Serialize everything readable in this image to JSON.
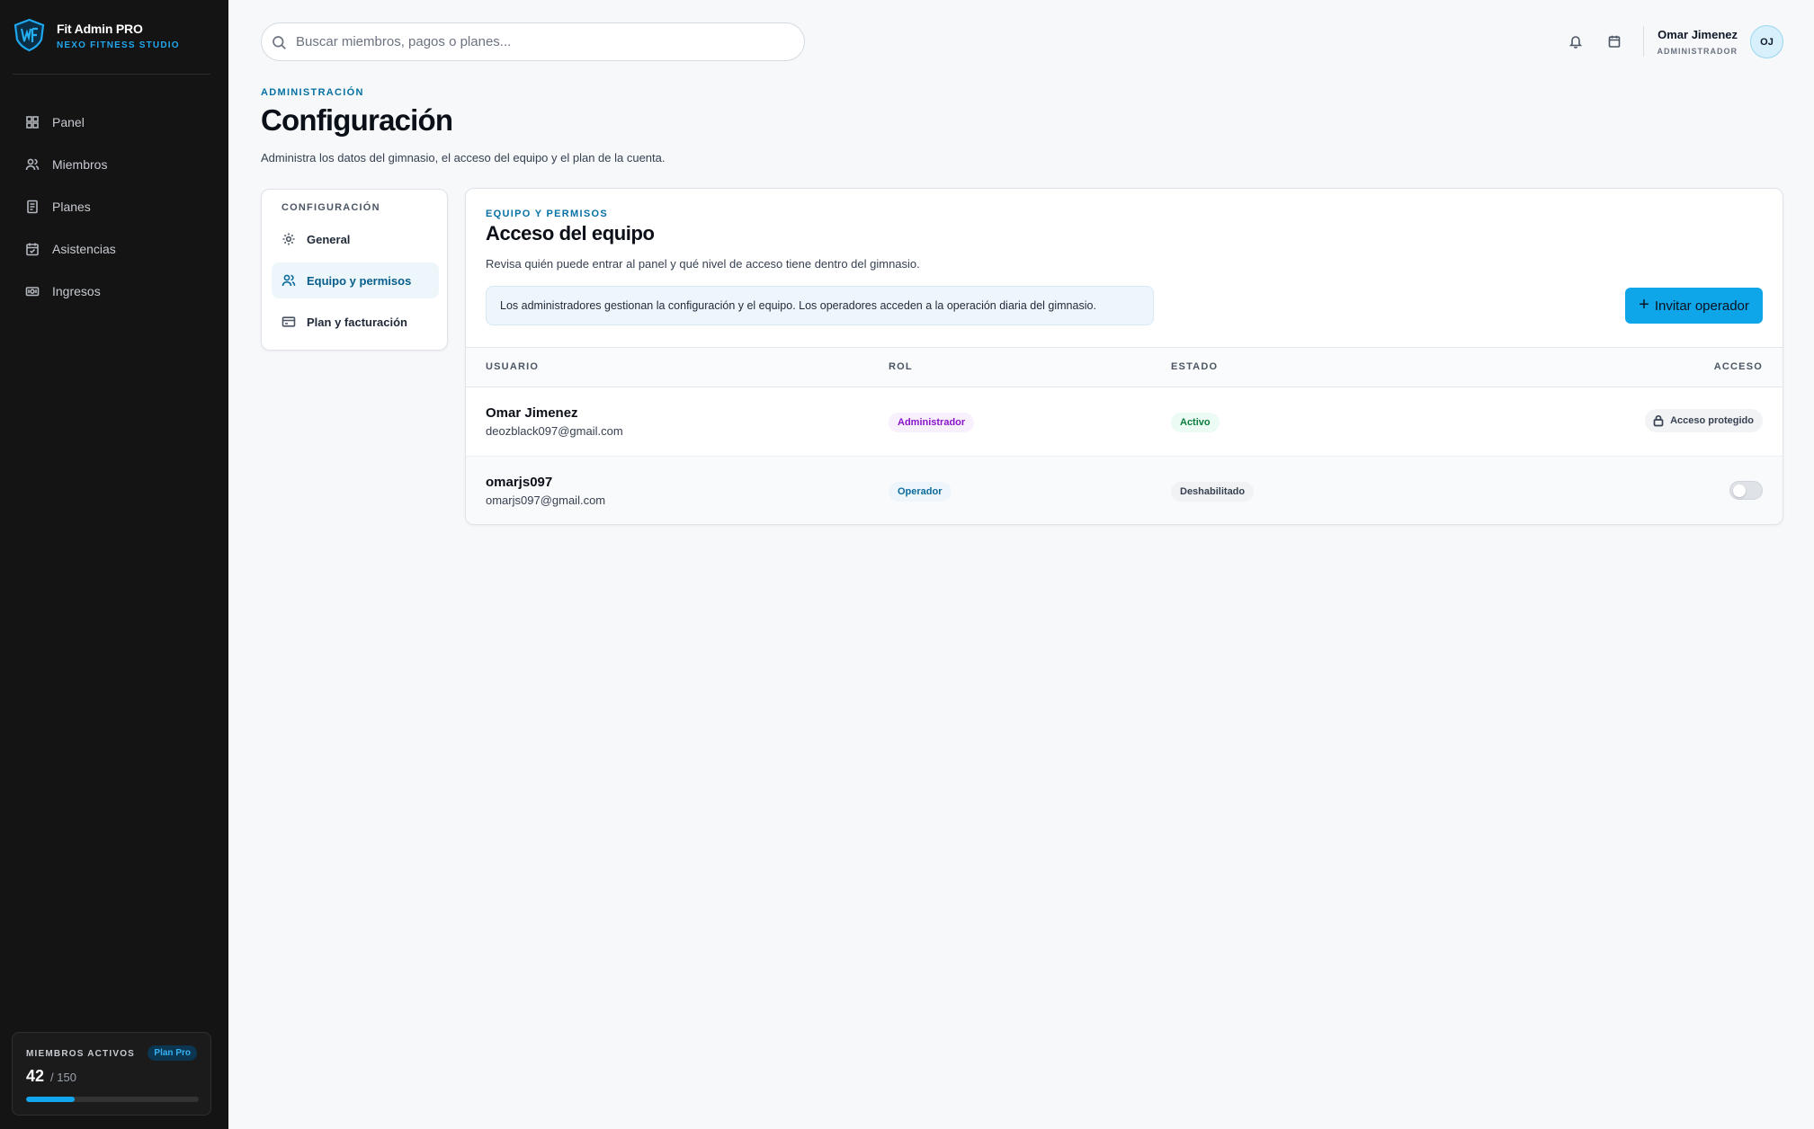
{
  "brand": {
    "title": "Fit Admin PRO",
    "subtitle": "NEXO FITNESS STUDIO"
  },
  "sidebar": {
    "items": [
      {
        "label": "Panel",
        "icon": "grid-icon"
      },
      {
        "label": "Miembros",
        "icon": "users-icon"
      },
      {
        "label": "Planes",
        "icon": "document-icon"
      },
      {
        "label": "Asistencias",
        "icon": "calendar-check-icon"
      },
      {
        "label": "Ingresos",
        "icon": "money-icon"
      }
    ],
    "members_card": {
      "label": "MIEMBROS ACTIVOS",
      "badge": "Plan Pro",
      "value": "42",
      "total": "/ 150",
      "progress_fraction": 0.28
    }
  },
  "topbar": {
    "search_placeholder": "Buscar miembros, pagos o planes...",
    "user": {
      "name": "Omar Jimenez",
      "role": "ADMINISTRADOR",
      "initials": "OJ"
    }
  },
  "header": {
    "eyebrow": "ADMINISTRACIÓN",
    "title": "Configuración",
    "description": "Administra los datos del gimnasio, el acceso del equipo y el plan de la cuenta."
  },
  "settings_nav": {
    "title": "CONFIGURACIÓN",
    "items": [
      {
        "label": "General",
        "icon": "gear-icon"
      },
      {
        "label": "Equipo y permisos",
        "icon": "users-icon",
        "active": true
      },
      {
        "label": "Plan y facturación",
        "icon": "credit-card-icon"
      }
    ]
  },
  "team": {
    "eyebrow": "EQUIPO Y PERMISOS",
    "title": "Acceso del equipo",
    "description": "Revisa quién puede entrar al panel y qué nivel de acceso tiene dentro del gimnasio.",
    "info": "Los administradores gestionan la configuración y el equipo. Los operadores acceden a la operación diaria del gimnasio.",
    "invite_label": "Invitar operador",
    "columns": [
      "USUARIO",
      "ROL",
      "ESTADO",
      "ACCESO"
    ],
    "rows": [
      {
        "name": "Omar Jimenez",
        "email": "deozblack097@gmail.com",
        "role": "Administrador",
        "status": "Activo",
        "access": "Acceso protegido"
      },
      {
        "name": "omarjs097",
        "email": "omarjs097@gmail.com",
        "role": "Operador",
        "status": "Deshabilitado",
        "access_enabled": false
      }
    ]
  },
  "colors": {
    "accent": "#0ea5e9",
    "sidebar_bg": "#141414",
    "eyebrow": "#0671a3"
  }
}
